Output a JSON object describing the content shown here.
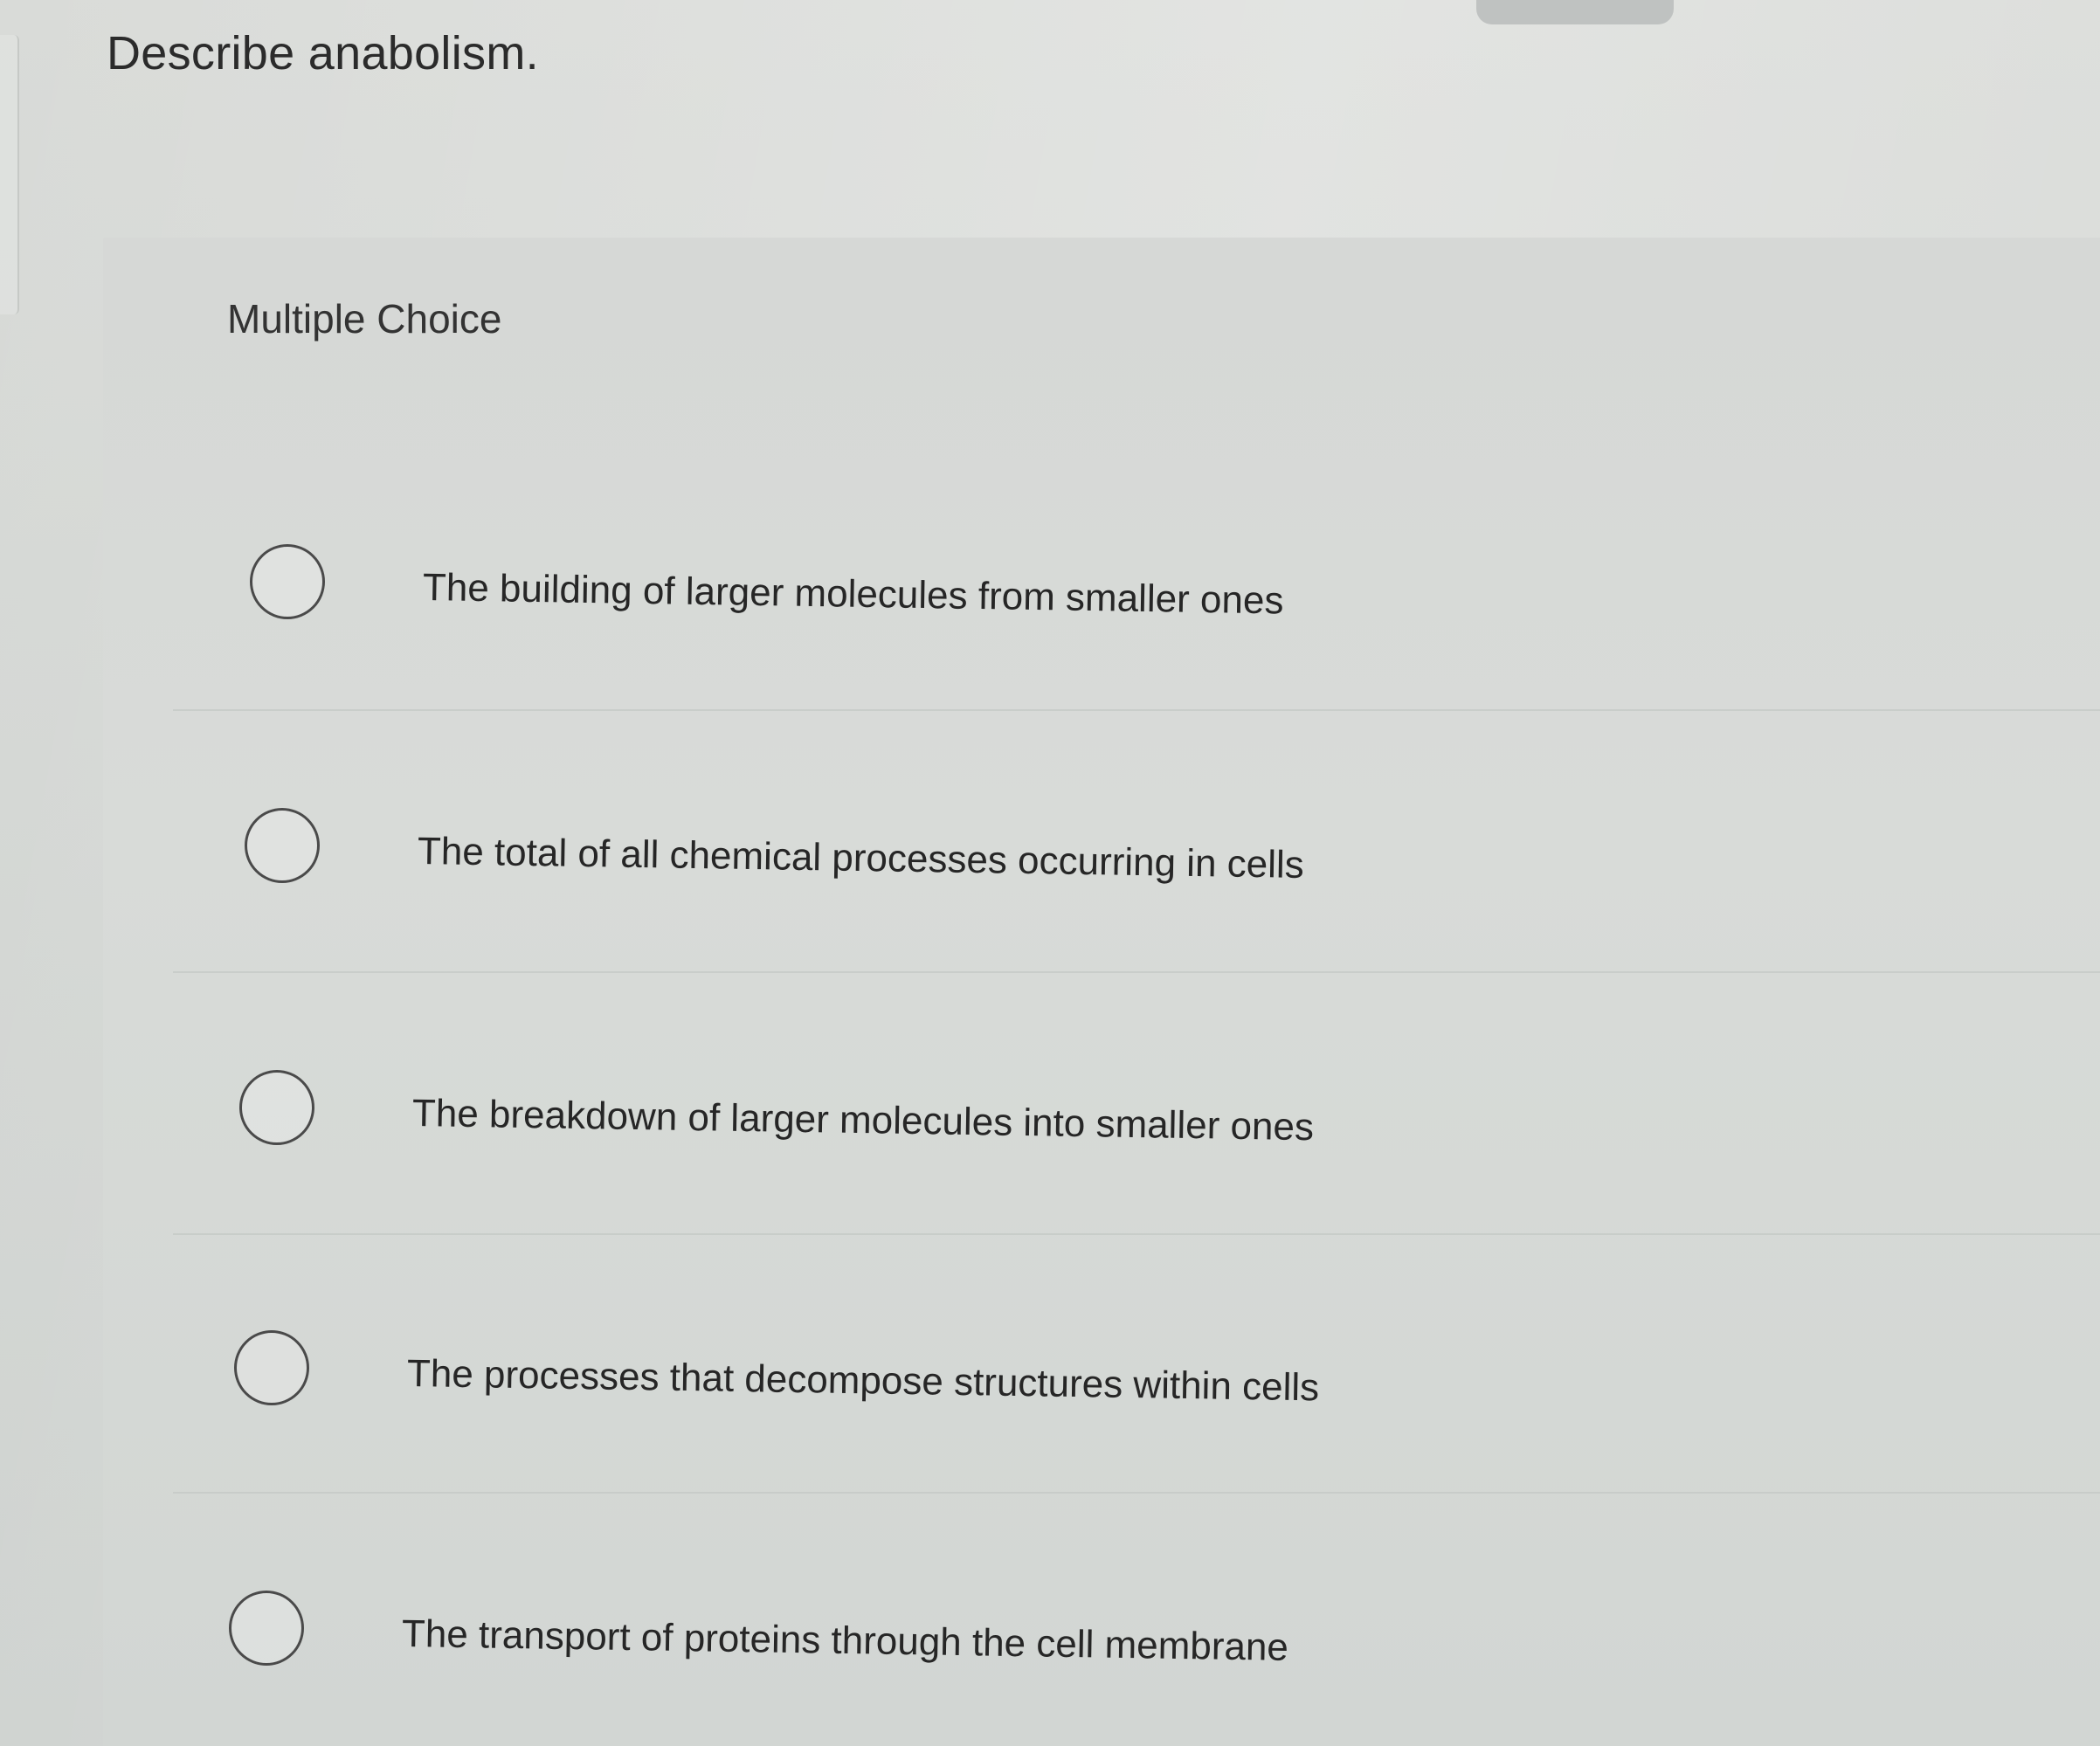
{
  "question": {
    "text": "Describe anabolism."
  },
  "panel": {
    "heading": "Multiple Choice"
  },
  "options": [
    {
      "label": "The building of larger molecules from smaller ones",
      "selected": false
    },
    {
      "label": "The total of all chemical processes occurring in cells",
      "selected": false
    },
    {
      "label": "The breakdown of larger molecules into smaller ones",
      "selected": false
    },
    {
      "label": "The processes that decompose structures within cells",
      "selected": false
    },
    {
      "label": "The transport of proteins through the cell membrane",
      "selected": false
    }
  ]
}
